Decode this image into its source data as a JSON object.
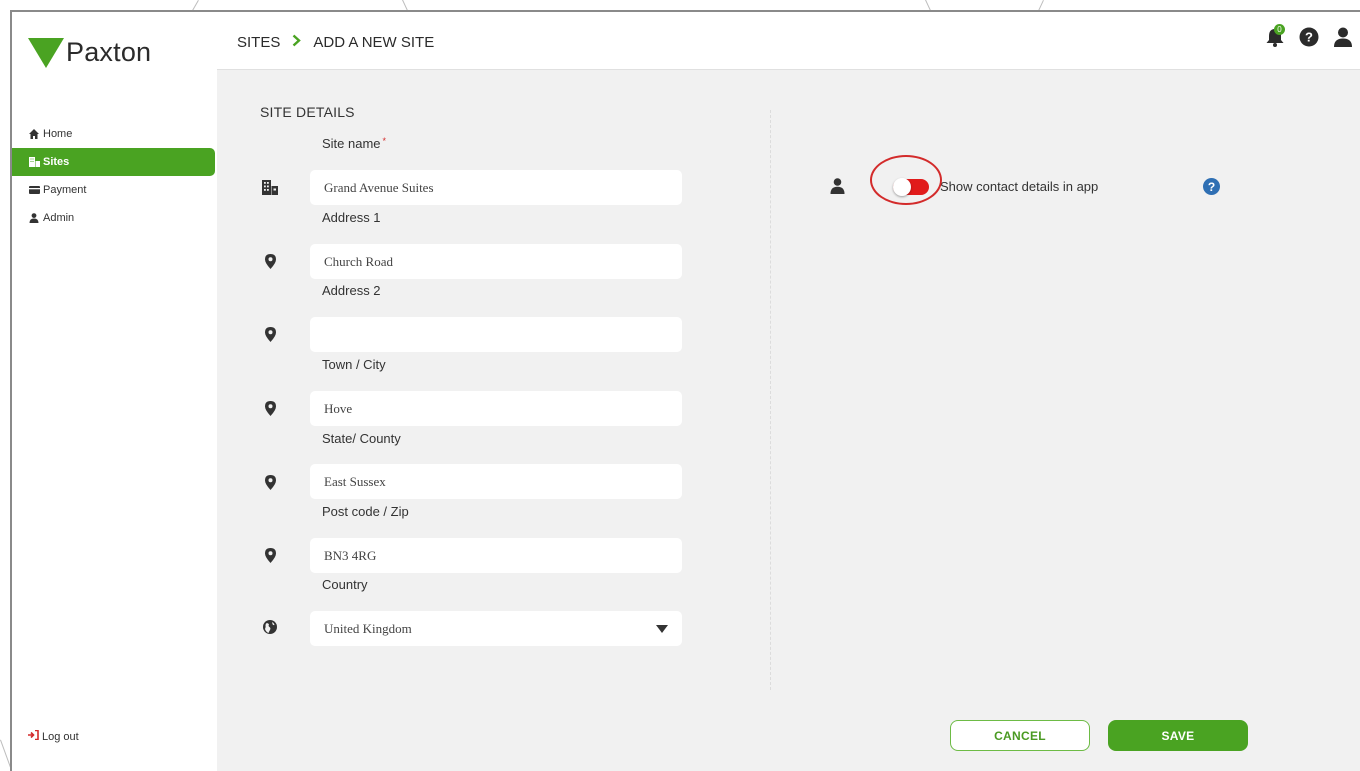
{
  "logo": {
    "text": "Paxton"
  },
  "sidebar": {
    "items": [
      {
        "label": "Home",
        "icon": "home-icon"
      },
      {
        "label": "Sites",
        "icon": "building-icon",
        "active": true
      },
      {
        "label": "Payment",
        "icon": "card-icon"
      },
      {
        "label": "Admin",
        "icon": "user-icon"
      }
    ],
    "logout_label": "Log out"
  },
  "header": {
    "breadcrumb": [
      "SITES",
      "ADD A NEW SITE"
    ],
    "notification_count": "0"
  },
  "form": {
    "section_title": "SITE DETAILS",
    "fields": [
      {
        "label": "Site name",
        "required": true,
        "value": "Grand Avenue Suites",
        "icon": "building-icon"
      },
      {
        "label": "Address 1",
        "value": "Church Road",
        "icon": "map-pin-icon"
      },
      {
        "label": "Address 2",
        "value": "",
        "icon": "map-pin-icon"
      },
      {
        "label": "Town / City",
        "value": "Hove",
        "icon": "map-pin-icon"
      },
      {
        "label": "State/ County",
        "value": "East Sussex",
        "icon": "map-pin-icon"
      },
      {
        "label": "Post code / Zip",
        "value": "BN3 4RG",
        "icon": "map-pin-icon"
      },
      {
        "label": "Country",
        "value": "United Kingdom",
        "icon": "globe-icon",
        "type": "select"
      }
    ],
    "required_mark": "*"
  },
  "contact": {
    "label": "Show contact details in app",
    "toggle_on": true,
    "help": "?"
  },
  "buttons": {
    "cancel": "CANCEL",
    "save": "SAVE"
  },
  "colors": {
    "brand_green": "#4aa322",
    "toggle_red": "#e11b1b",
    "help_blue": "#2f6fb3",
    "main_bg": "#f1f1f1"
  }
}
